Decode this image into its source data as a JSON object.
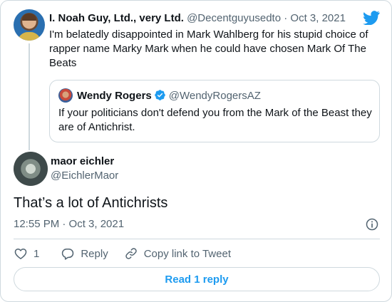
{
  "parent_tweet": {
    "author_name": "I. Noah Guy, Ltd., very Ltd.",
    "handle": "@Decentguyusedto",
    "separator": "·",
    "date": "Oct 3, 2021",
    "text": "I'm belatedly disappointed in Mark Wahlberg for his stupid choice of rapper name Marky Mark when he could have chosen Mark Of The Beats"
  },
  "quoted_tweet": {
    "author_name": "Wendy Rogers",
    "handle": "@WendyRogersAZ",
    "text": "If your politicians don't defend you from the Mark of the Beast they are of Antichrist."
  },
  "main_tweet": {
    "author_name": "maor eichler",
    "handle": "@EichlerMaor",
    "text": "That’s a lot of Antichrists",
    "timestamp": "12:55 PM · Oct 3, 2021"
  },
  "actions": {
    "like_count": "1",
    "reply_label": "Reply",
    "copy_link_label": "Copy link to Tweet"
  },
  "read_replies_label": "Read 1 reply",
  "colors": {
    "accent": "#1d9bf0",
    "text": "#0f1419",
    "muted": "#536471",
    "border": "#cfd9de"
  },
  "icons": {
    "brand": "twitter-bird-icon",
    "verified": "verified-badge-icon",
    "info": "info-icon",
    "like": "heart-icon",
    "reply": "reply-bubble-icon",
    "copy_link": "link-icon"
  }
}
